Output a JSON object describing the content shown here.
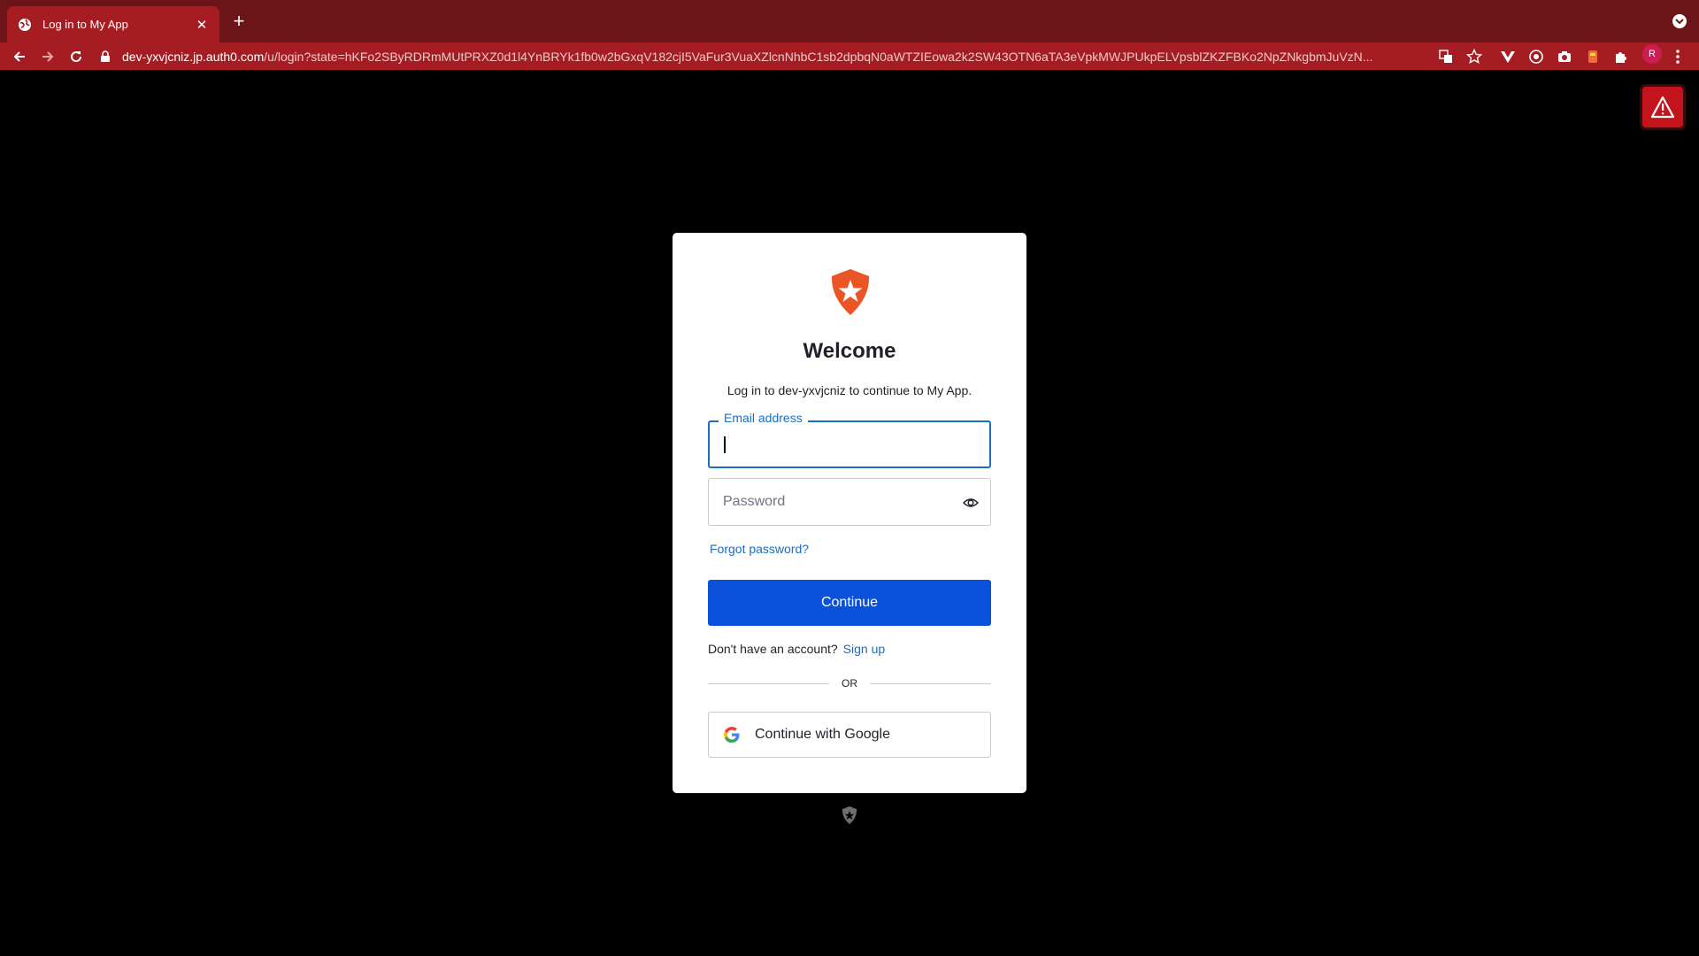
{
  "browser": {
    "tab_title": "Log in to My App",
    "url_domain": "dev-yxvjcniz.jp.auth0.com",
    "url_path": "/u/login?state=hKFo2SByRDRmMUtPRXZ0d1l4YnBRYk1fb0w2bGxqV182cjI5VaFur3VuaXZlcnNhbC1sb2dpbqN0aWTZIEowa2k2SW43OTN6aTA3eVpkMWJPUkpELVpsblZKZFBKo2NpZNkgbmJuVzN...",
    "profile_initial": "R",
    "theme_color": "#a51d22"
  },
  "login": {
    "title": "Welcome",
    "subtitle": "Log in to dev-yxvjcniz to continue to My App.",
    "email_label": "Email address",
    "password_placeholder": "Password",
    "forgot_password": "Forgot password?",
    "continue_label": "Continue",
    "no_account_text": "Don't have an account?",
    "signup_link": "Sign up",
    "divider_text": "OR",
    "google_label": "Continue with Google",
    "accent_color": "#0a50d8",
    "logo_color": "#eb5424"
  }
}
